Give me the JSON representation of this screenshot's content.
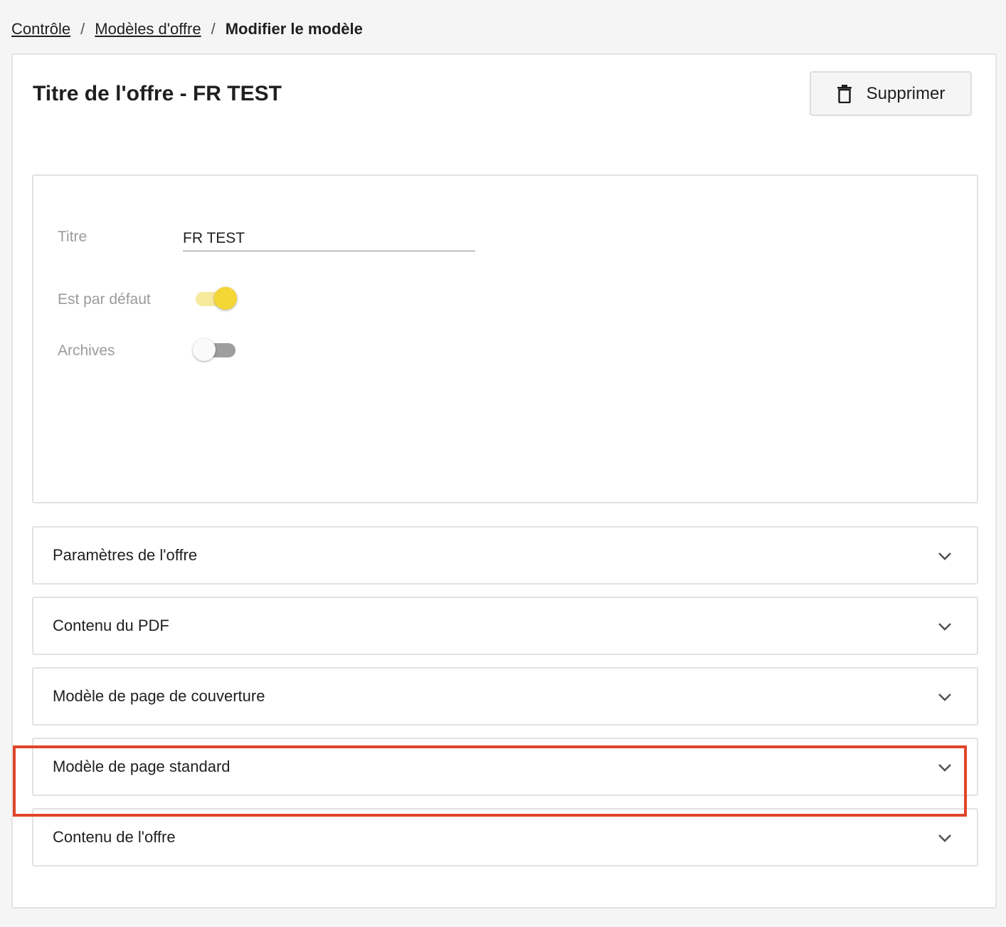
{
  "breadcrumb": {
    "items": [
      "Contrôle",
      "Modèles d'offre"
    ],
    "separator": "/",
    "current": "Modifier le modèle"
  },
  "header": {
    "title": "Titre de l'offre - FR TEST",
    "delete_label": "Supprimer",
    "delete_icon": "trash-icon"
  },
  "form": {
    "title_label": "Titre",
    "title_value": "FR TEST",
    "default_label": "Est par défaut",
    "default_on": true,
    "archives_label": "Archives",
    "archives_on": false
  },
  "sections": [
    "Paramètres de l'offre",
    "Contenu du PDF",
    "Modèle de page de couverture",
    "Modèle de page standard",
    "Contenu de l'offre"
  ],
  "colors": {
    "accent": "#f4d635",
    "highlight": "#e0452a"
  }
}
